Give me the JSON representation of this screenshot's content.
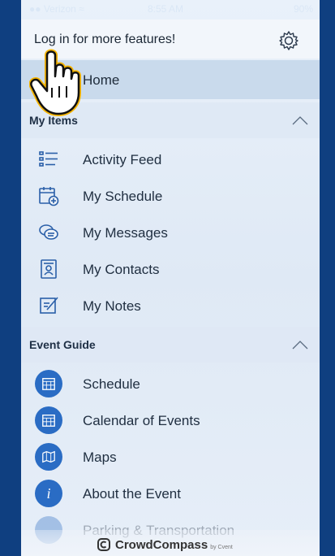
{
  "status_bar": {
    "carrier": "●● Verizon ≈",
    "time": "8:55 AM",
    "battery": "90%"
  },
  "login": {
    "text": "Log in for more features!"
  },
  "home": {
    "label": "Home"
  },
  "my_items": {
    "title": "My Items",
    "items": [
      {
        "label": "Activity Feed",
        "icon": "list-icon"
      },
      {
        "label": "My Schedule",
        "icon": "calendar-add-icon"
      },
      {
        "label": "My Messages",
        "icon": "chat-bubbles-icon"
      },
      {
        "label": "My Contacts",
        "icon": "contact-book-icon"
      },
      {
        "label": "My Notes",
        "icon": "note-pencil-icon"
      }
    ]
  },
  "event_guide": {
    "title": "Event Guide",
    "items": [
      {
        "label": "Schedule",
        "icon": "calendar-grid-icon"
      },
      {
        "label": "Calendar of Events",
        "icon": "calendar-grid-icon"
      },
      {
        "label": "Maps",
        "icon": "map-icon"
      },
      {
        "label": "About the Event",
        "icon": "info-icon"
      },
      {
        "label": "Parking & Transportation",
        "icon": "parking-icon"
      }
    ]
  },
  "footer": {
    "brand": "CrowdCompass",
    "by": "by Cvent"
  },
  "colors": {
    "accent": "#2a6cc4",
    "background": "#0f3f80"
  }
}
